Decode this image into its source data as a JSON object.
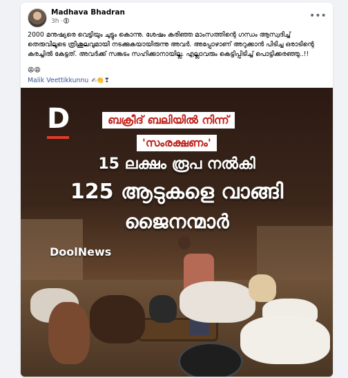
{
  "post": {
    "author": "Madhava Bhadran",
    "time": "3h",
    "separator": "·",
    "more": "•••",
    "text": "2000 മനുഷ്യരെ വെട്ടിയും ചുട്ടും കൊന്നു. ശേഷം കരിഞ്ഞ മാംസത്തിന്റെ ഗന്ധം ആസ്വദിച്ച് തെരുവിലൂടെ ത്രിശൂലവുമായി നടക്കുകയായിരുന്നു അവർ. അപ്പോഴാണ് അറുക്കാൻ പിടിച്ച ഒരാടിന്റെ കരച്ചിൽ കേട്ടത്. അവർക്ക് സങ്കടം സഹിക്കാനായില്ല. എല്ലാവരും കെട്ടിപ്പിടിച്ച് പൊട്ടിക്കരഞ്ഞു..!!",
    "emojis": "😩😩",
    "mention": "Malik Veettikkunnu",
    "mention_icons": "✍👏❣"
  },
  "image": {
    "logo_letter": "D",
    "banner_line1": "ബക്രീദ് ബലിയിൽ നിന്ന്",
    "banner_line2": "'സംരക്ഷണം'",
    "headline1": "15 ലക്ഷം രൂപ നൽകി",
    "headline2": "125 ആടുകളെ വാങ്ങി",
    "headline3": "ജൈനന്മാർ",
    "watermark_main": "Dool",
    "watermark_accent": "News"
  },
  "colors": {
    "link": "#385898",
    "accent_red": "#c0201a",
    "logo_red": "#e23b2a"
  }
}
